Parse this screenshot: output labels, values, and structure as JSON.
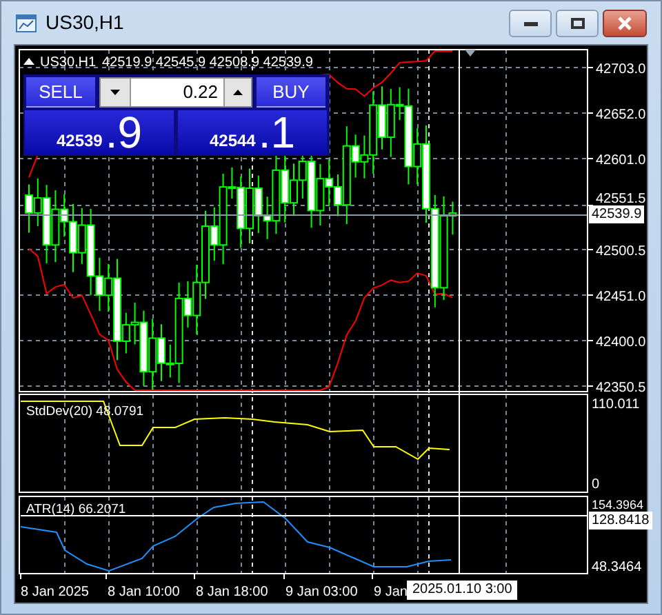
{
  "window": {
    "title": "US30,H1"
  },
  "chart": {
    "header": {
      "symbol": "US30,H1",
      "ohlc": "42519.9 42545.9 42508.9 42539.9"
    },
    "trade_panel": {
      "sell_label": "SELL",
      "buy_label": "BUY",
      "volume": "0.22",
      "sell_price": "42539",
      "sell_digit": ".9",
      "buy_price": "42544",
      "buy_digit": ".1"
    },
    "price_axis": [
      "42703.0",
      "42652.0",
      "42601.0",
      "42551.5",
      "42500.5",
      "42451.0",
      "42400.0",
      "42350.5"
    ],
    "current_price": "42539.9"
  },
  "stddev_pane": {
    "label": "StdDev(20) 48.0791",
    "axis": [
      "110.011",
      "0"
    ]
  },
  "atr_pane": {
    "label": "ATR(14) 66.2071",
    "axis": [
      "154.3964",
      "48.3464"
    ],
    "crosshair_value": "128.8418"
  },
  "time_axis": [
    "8 Jan 2025",
    "8 Jan 10:00",
    "8 Jan 18:00",
    "9 Jan 03:00",
    "9 Jan"
  ],
  "crosshair_time": "2025.01.10 3:00"
}
